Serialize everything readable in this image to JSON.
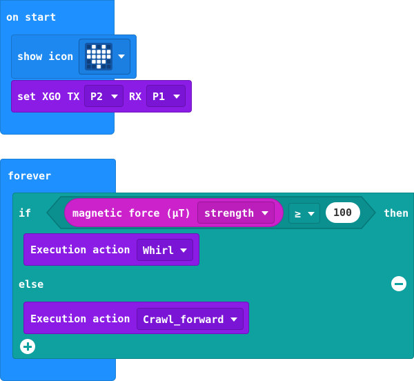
{
  "on_start": {
    "label": "on start",
    "show_icon_label": "show icon",
    "icon_name": "heart-icon",
    "set_xgo": {
      "label": "set XGO TX",
      "tx_value": "P2",
      "rx_label": "RX",
      "rx_value": "P1"
    }
  },
  "forever": {
    "label": "forever",
    "if_label": "if",
    "then_label": "then",
    "condition": {
      "sensor_label": "magnetic force (µT)",
      "sensor_value": "strength",
      "operator": "≥",
      "threshold": "100"
    },
    "then_action": {
      "label": "Execution action",
      "value": "Whirl"
    },
    "else_label": "else",
    "else_action": {
      "label": "Execution action",
      "value": "Crawl_forward"
    }
  },
  "colors": {
    "basic_blue": "#1e90ff",
    "xgo_purple": "#8a1ce6",
    "logic_teal": "#0fa0a0",
    "input_magenta": "#cc22cc"
  }
}
